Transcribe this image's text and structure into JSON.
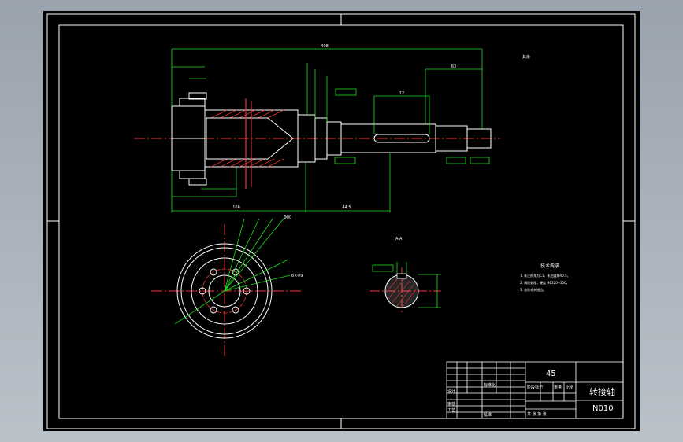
{
  "drawing": {
    "title_part_name": "转接轴",
    "drawing_number": "N010",
    "material": "45",
    "title_block_labels": {
      "standard": "标准化",
      "process": "工艺",
      "approve": "批准",
      "stage_mark": "阶段标记",
      "weight": "重量",
      "scale": "比例",
      "sheets": "共 张 第 张",
      "design": "设计",
      "review": "审核"
    },
    "technical_requirements": {
      "heading": "技术要求",
      "items": [
        "1. 未注倒角为C1，未注圆角R0.5。",
        "2. 调质处理，硬度 HB220~250。",
        "3. 去除毛刺锐边。"
      ]
    },
    "section_label": "A-A",
    "surface_roughness_note": "其余",
    "dimensions": {
      "overall_length": "408",
      "lower_length": "44.5",
      "left_length": "166",
      "right_length": "63",
      "keyway_width": "12",
      "shaft_diameter": "Φ35",
      "flange_holes": "6×Φ9",
      "pcd": "Φ80",
      "bore_diameter": "Φ40",
      "section_width": "20",
      "section_depth": "38"
    }
  }
}
